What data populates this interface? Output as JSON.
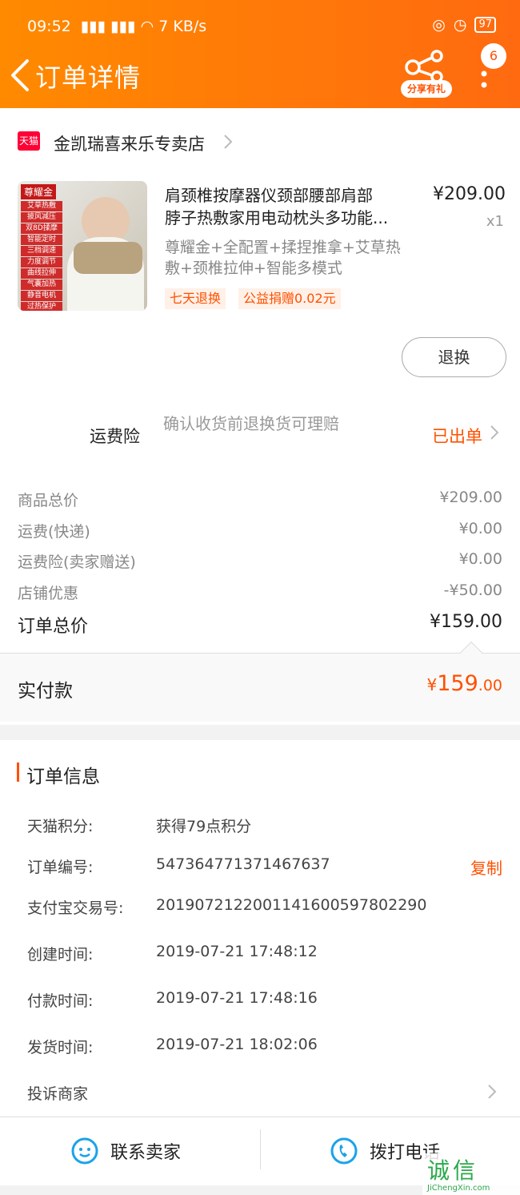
{
  "status_bar": {
    "time": "09:52",
    "net": "7 KB/s",
    "battery": "97"
  },
  "header": {
    "title": "订单详情",
    "share_label": "分享有礼",
    "badge_count": "6"
  },
  "shop": {
    "platform_tag": "天猫",
    "name": "金凯瑞喜来乐专卖店"
  },
  "product": {
    "name_line1": "肩颈椎按摩器仪颈部腰部肩部",
    "name_line2": "脖子热敷家用电动枕头多功能...",
    "sku_line1": "尊耀金+全配置+揉捏推拿+艾草热",
    "sku_line2": "敷+颈椎拉伸+智能多模式",
    "price": "¥209.00",
    "qty": "x1",
    "tags": [
      "七天退换",
      "公益捐赠0.02元"
    ],
    "thumb_tag": "尊耀金",
    "thumb_features": [
      "艾草热敷",
      "披风减压",
      "双8D揉摩",
      "智能定时",
      "三档调速",
      "力度调节",
      "曲线拉伸",
      "气囊加热",
      "静音电机",
      "过热保护"
    ],
    "return_button": "退换"
  },
  "insurance": {
    "label": "运费险",
    "desc": "确认收货前退换货可理赔",
    "status": "已出单"
  },
  "costs": [
    {
      "label": "商品总价",
      "value": "¥209.00"
    },
    {
      "label": "运费(快递)",
      "value": "¥0.00"
    },
    {
      "label": "运费险(卖家赠送)",
      "value": "¥0.00"
    },
    {
      "label": "店铺优惠",
      "value": "-¥50.00"
    }
  ],
  "order_total": {
    "label": "订单总价",
    "value": "¥159.00"
  },
  "paid": {
    "label": "实付款",
    "currency": "¥",
    "integer": "159",
    "decimal": ".00"
  },
  "order_info": {
    "title": "订单信息",
    "rows": [
      {
        "label": "天猫积分:",
        "value": "获得79点积分"
      },
      {
        "label": "订单编号:",
        "value": "547364771371467637"
      },
      {
        "label": "支付宝交易号:",
        "value": "2019072122001141600597802290"
      },
      {
        "label": "创建时间:",
        "value": "2019-07-21 17:48:12"
      },
      {
        "label": "付款时间:",
        "value": "2019-07-21 17:48:16"
      },
      {
        "label": "发货时间:",
        "value": "2019-07-21 18:02:06"
      }
    ],
    "copy_label": "复制",
    "complain_label": "投诉商家"
  },
  "bottom_bar": {
    "contact_seller": "联系卖家",
    "call_phone": "拨打电话"
  },
  "watermark": {
    "text": "诚信",
    "url": "JiChengXin.com"
  },
  "colors": {
    "accent": "#ff5000",
    "header_start": "#ff8a00",
    "header_end": "#ff6a10",
    "icon_blue": "#1aa3e8"
  }
}
